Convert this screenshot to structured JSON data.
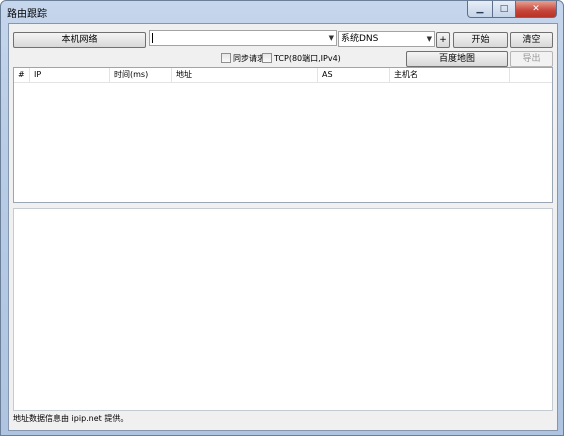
{
  "window": {
    "title": "路由跟踪",
    "min_glyph": "▁",
    "max_glyph": "□",
    "close_glyph": "✕"
  },
  "toolbar": {
    "local_network_label": "本机网络",
    "target_input_value": "",
    "dns_selected": "系统DNS",
    "add_label": "+",
    "start_label": "开始",
    "clear_label": "清空",
    "sync_request_label": "同步请求",
    "tcp_label": "TCP(80端口,IPv4)",
    "sync_request_checked": false,
    "tcp_checked": false,
    "baidu_map_label": "百度地图",
    "export_label": "导出"
  },
  "table": {
    "columns": [
      "#",
      "IP",
      "时间(ms)",
      "地址",
      "AS",
      "主机名",
      ""
    ],
    "rows": []
  },
  "status": {
    "text": "地址数据信息由 ipip.net 提供。"
  }
}
